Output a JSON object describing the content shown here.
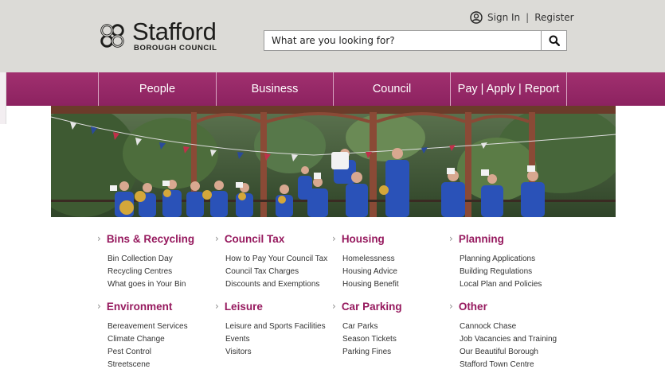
{
  "header": {
    "logo": {
      "name": "Stafford",
      "subtitle": "BOROUGH COUNCIL"
    },
    "account": {
      "sign_in": "Sign In",
      "separator": "|",
      "register": "Register"
    },
    "search": {
      "placeholder": "What are you looking for?"
    }
  },
  "nav": {
    "items": [
      {
        "label": "People"
      },
      {
        "label": "Business"
      },
      {
        "label": "Council"
      },
      {
        "label": "Pay | Apply | Report"
      }
    ]
  },
  "sections": [
    {
      "title": "Bins & Recycling",
      "links": [
        "Bin Collection Day",
        "Recycling Centres",
        "What goes in Your Bin"
      ]
    },
    {
      "title": "Council Tax",
      "links": [
        "How to Pay Your Council Tax",
        "Council Tax Charges",
        "Discounts and Exemptions"
      ]
    },
    {
      "title": "Housing",
      "links": [
        "Homelessness",
        "Housing Advice",
        "Housing Benefit"
      ]
    },
    {
      "title": "Planning",
      "links": [
        "Planning Applications",
        "Building Regulations",
        "Local Plan and Policies"
      ]
    },
    {
      "title": "Environment",
      "links": [
        "Bereavement Services",
        "Climate Change",
        "Pest Control",
        "Streetscene"
      ]
    },
    {
      "title": "Leisure",
      "links": [
        "Leisure and Sports Facilities",
        "Events",
        "Visitors"
      ]
    },
    {
      "title": "Car Parking",
      "links": [
        "Car Parks",
        "Season Tickets",
        "Parking Fines"
      ]
    },
    {
      "title": "Other",
      "links": [
        "Cannock Chase",
        "Job Vacancies and Training",
        "Our Beautiful Borough",
        "Stafford Town Centre"
      ]
    }
  ],
  "colors": {
    "brand": "#96195e",
    "nav": "#962a68",
    "header_bg": "#dcdbd7"
  },
  "icons": {
    "account": "user-circle-icon",
    "search": "search-icon",
    "chevron": "chevron-right-icon",
    "logo": "stafford-knot-logo"
  }
}
